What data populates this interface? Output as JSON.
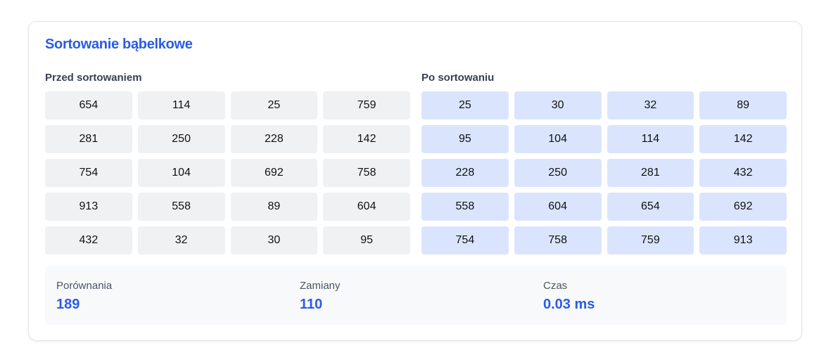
{
  "title": "Sortowanie bąbelkowe",
  "before": {
    "label": "Przed sortowaniem",
    "values": [
      654,
      114,
      25,
      759,
      281,
      250,
      228,
      142,
      754,
      104,
      692,
      758,
      913,
      558,
      89,
      604,
      432,
      32,
      30,
      95
    ]
  },
  "after": {
    "label": "Po sortowaniu",
    "values": [
      25,
      30,
      32,
      89,
      95,
      104,
      114,
      142,
      228,
      250,
      281,
      432,
      558,
      604,
      654,
      692,
      754,
      758,
      759,
      913
    ]
  },
  "stats": [
    {
      "label": "Porównania",
      "value": "189"
    },
    {
      "label": "Zamiany",
      "value": "110"
    },
    {
      "label": "Czas",
      "value": "0.03 ms"
    }
  ],
  "colors": {
    "accent": "#2b5be6",
    "before_cell": "#f0f1f3",
    "after_cell": "#dae5fd"
  }
}
